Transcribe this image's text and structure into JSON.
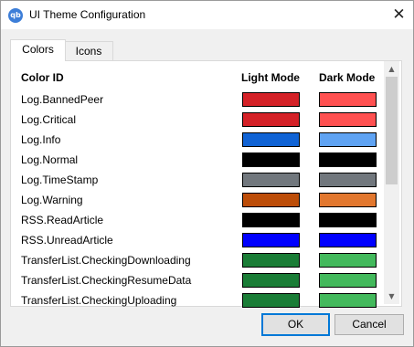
{
  "window": {
    "title": "UI Theme Configuration",
    "app_icon_text": "qb",
    "close_glyph": "✕"
  },
  "tabs": [
    {
      "label": "Colors",
      "active": true
    },
    {
      "label": "Icons",
      "active": false
    }
  ],
  "table": {
    "headers": {
      "id": "Color ID",
      "light": "Light Mode",
      "dark": "Dark Mode"
    },
    "rows": [
      {
        "id": "Log.BannedPeer",
        "light": "#d42127",
        "dark": "#ff5151"
      },
      {
        "id": "Log.Critical",
        "light": "#d42127",
        "dark": "#ff5151"
      },
      {
        "id": "Log.Info",
        "light": "#1063d5",
        "dark": "#5fa3f3"
      },
      {
        "id": "Log.Normal",
        "light": "#000000",
        "dark": "#000000"
      },
      {
        "id": "Log.TimeStamp",
        "light": "#71777d",
        "dark": "#71777d"
      },
      {
        "id": "Log.Warning",
        "light": "#bd4d08",
        "dark": "#e2772e"
      },
      {
        "id": "RSS.ReadArticle",
        "light": "#000000",
        "dark": "#000000"
      },
      {
        "id": "RSS.UnreadArticle",
        "light": "#0000ff",
        "dark": "#0000ff"
      },
      {
        "id": "TransferList.CheckingDownloading",
        "light": "#1a7d36",
        "dark": "#43b95c"
      },
      {
        "id": "TransferList.CheckingResumeData",
        "light": "#1a7d36",
        "dark": "#43b95c"
      },
      {
        "id": "TransferList.CheckingUploading",
        "light": "#1a7d36",
        "dark": "#43b95c"
      }
    ]
  },
  "scrollbar": {
    "up_glyph": "▲",
    "down_glyph": "▼"
  },
  "buttons": {
    "ok": "OK",
    "cancel": "Cancel"
  }
}
